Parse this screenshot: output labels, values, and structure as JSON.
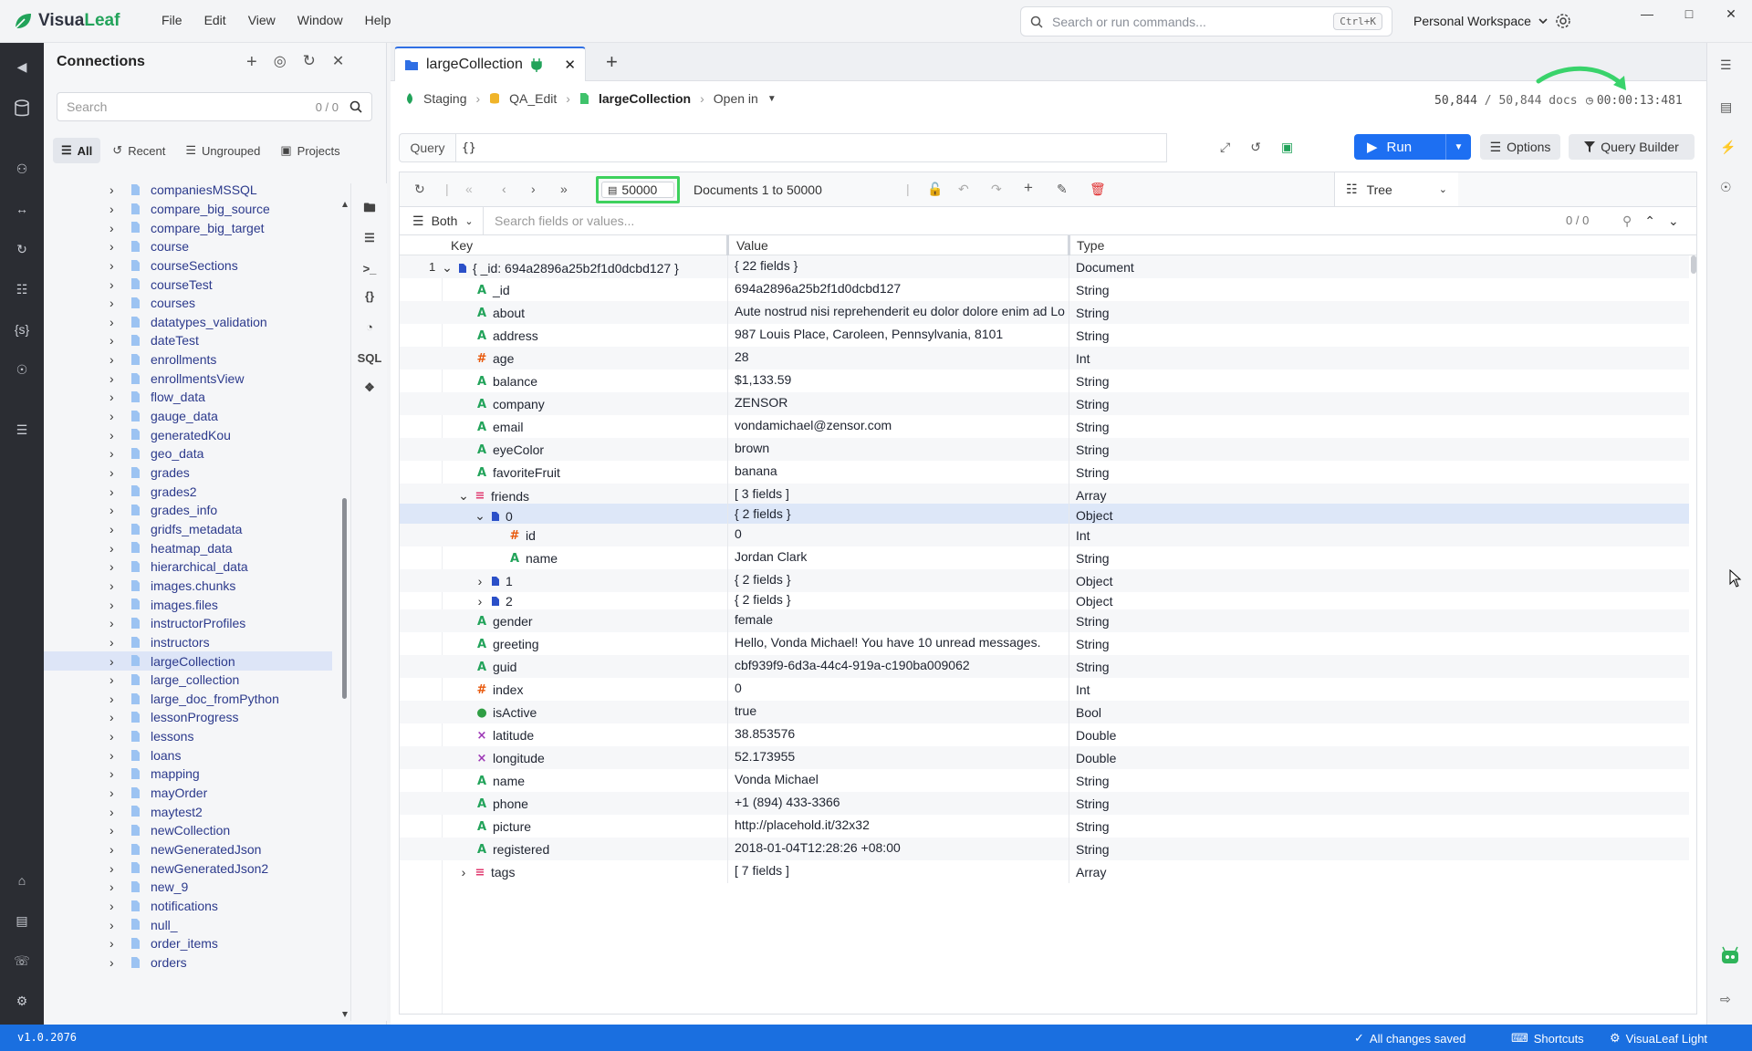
{
  "app": {
    "name_a": "Visua",
    "name_b": "Leaf",
    "menu": [
      "File",
      "Edit",
      "View",
      "Window",
      "Help"
    ],
    "search_placeholder": "Search or run commands...",
    "search_shortcut": "Ctrl+K",
    "workspace": "Personal Workspace",
    "accent": "#1d6ff2",
    "brand_green": "#22a35a"
  },
  "connections": {
    "title": "Connections",
    "search_placeholder": "Search",
    "search_count": "0 / 0",
    "filters": [
      "All",
      "Recent",
      "Ungrouped",
      "Projects"
    ],
    "items": [
      "companiesMSSQL",
      "compare_big_source",
      "compare_big_target",
      "course",
      "courseSections",
      "courseTest",
      "courses",
      "datatypes_validation",
      "dateTest",
      "enrollments",
      "enrollmentsView",
      "flow_data",
      "gauge_data",
      "generatedKou",
      "geo_data",
      "grades",
      "grades2",
      "grades_info",
      "gridfs_metadata",
      "heatmap_data",
      "hierarchical_data",
      "images.chunks",
      "images.files",
      "instructorProfiles",
      "instructors",
      "largeCollection",
      "large_collection",
      "large_doc_fromPython",
      "lessonProgress",
      "lessons",
      "loans",
      "mapping",
      "mayOrder",
      "maytest2",
      "newCollection",
      "newGeneratedJson",
      "newGeneratedJson2",
      "new_9",
      "notifications",
      "null_",
      "order_items",
      "orders"
    ],
    "selected": "largeCollection",
    "side_tools": [
      "folder-icon",
      "list-icon",
      "terminal-icon",
      "braces-icon",
      "pie-chart-icon",
      "SQL",
      "puzzle-icon"
    ]
  },
  "tab": {
    "label": "largeCollection"
  },
  "breadcrumb": {
    "connection": "Staging",
    "database": "QA_Edit",
    "collection": "largeCollection",
    "open_in": "Open in"
  },
  "stats": {
    "docs_shown": "50,844",
    "docs_total": "50,844 docs",
    "elapsed": "00:00:13:481"
  },
  "query": {
    "label": "Query",
    "value": "{}",
    "run": "Run",
    "options": "Options",
    "builder": "Query Builder"
  },
  "results": {
    "page_size": "50000",
    "range": "Documents 1 to 50000",
    "view_mode": "Tree",
    "filter_mode": "Both",
    "filter_placeholder": "Search fields or values...",
    "filter_count": "0 / 0",
    "columns": [
      "Key",
      "Value",
      "Type"
    ],
    "rows": [
      {
        "n": "1",
        "level": 0,
        "toggle": "down",
        "icon": "doc",
        "key": "{ _id: 694a2896a25b2f1d0dcbd127 }",
        "value": "{ 22 fields }",
        "type": "Document"
      },
      {
        "level": 1,
        "icon": "A",
        "key": "_id",
        "value": "694a2896a25b2f1d0dcbd127",
        "type": "String"
      },
      {
        "level": 1,
        "icon": "A",
        "key": "about",
        "value": "Aute nostrud nisi reprehenderit eu dolor dolore enim ad Lorem. Velit",
        "type": "String"
      },
      {
        "level": 1,
        "icon": "A",
        "key": "address",
        "value": "987 Louis Place, Caroleen, Pennsylvania, 8101",
        "type": "String"
      },
      {
        "level": 1,
        "icon": "#",
        "key": "age",
        "value": "28",
        "type": "Int"
      },
      {
        "level": 1,
        "icon": "A",
        "key": "balance",
        "value": "$1,133.59",
        "type": "String"
      },
      {
        "level": 1,
        "icon": "A",
        "key": "company",
        "value": "ZENSOR",
        "type": "String"
      },
      {
        "level": 1,
        "icon": "A",
        "key": "email",
        "value": "vondamichael@zensor.com",
        "type": "String"
      },
      {
        "level": 1,
        "icon": "A",
        "key": "eyeColor",
        "value": "brown",
        "type": "String"
      },
      {
        "level": 1,
        "icon": "A",
        "key": "favoriteFruit",
        "value": "banana",
        "type": "String"
      },
      {
        "level": 1,
        "toggle": "down",
        "icon": "arr",
        "key": "friends",
        "value": "[ 3 fields ]",
        "type": "Array"
      },
      {
        "level": 2,
        "toggle": "down",
        "icon": "doc",
        "key": "0",
        "value": "{ 2 fields }",
        "type": "Object",
        "selected": true
      },
      {
        "level": 3,
        "icon": "#",
        "key": "id",
        "value": "0",
        "type": "Int"
      },
      {
        "level": 3,
        "icon": "A",
        "key": "name",
        "value": "Jordan Clark",
        "type": "String"
      },
      {
        "level": 2,
        "toggle": "right",
        "icon": "doc",
        "key": "1",
        "value": "{ 2 fields }",
        "type": "Object"
      },
      {
        "level": 2,
        "toggle": "right",
        "icon": "doc",
        "key": "2",
        "value": "{ 2 fields }",
        "type": "Object"
      },
      {
        "level": 1,
        "icon": "A",
        "key": "gender",
        "value": "female",
        "type": "String"
      },
      {
        "level": 1,
        "icon": "A",
        "key": "greeting",
        "value": "Hello, Vonda Michael! You have 10 unread messages.",
        "type": "String"
      },
      {
        "level": 1,
        "icon": "A",
        "key": "guid",
        "value": "cbf939f9-6d3a-44c4-919a-c190ba009062",
        "type": "String"
      },
      {
        "level": 1,
        "icon": "#",
        "key": "index",
        "value": "0",
        "type": "Int"
      },
      {
        "level": 1,
        "icon": "bool",
        "key": "isActive",
        "value": "true",
        "type": "Bool"
      },
      {
        "level": 1,
        "icon": "dbl",
        "key": "latitude",
        "value": "38.853576",
        "type": "Double"
      },
      {
        "level": 1,
        "icon": "dbl",
        "key": "longitude",
        "value": "52.173955",
        "type": "Double"
      },
      {
        "level": 1,
        "icon": "A",
        "key": "name",
        "value": "Vonda Michael",
        "type": "String"
      },
      {
        "level": 1,
        "icon": "A",
        "key": "phone",
        "value": "+1 (894) 433-3366",
        "type": "String"
      },
      {
        "level": 1,
        "icon": "A",
        "key": "picture",
        "value": "http://placehold.it/32x32",
        "type": "String"
      },
      {
        "level": 1,
        "icon": "A",
        "key": "registered",
        "value": "2018-01-04T12:28:26 +08:00",
        "type": "String"
      },
      {
        "level": 1,
        "toggle": "right",
        "icon": "arr",
        "key": "tags",
        "value": "[ 7 fields ]",
        "type": "Array"
      }
    ]
  },
  "status": {
    "version": "v1.0.2076",
    "saved": "All changes saved",
    "shortcuts": "Shortcuts",
    "theme": "VisuaLeaf Light"
  }
}
